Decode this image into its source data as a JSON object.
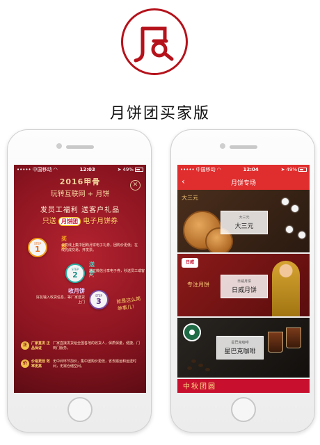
{
  "app": {
    "title": "月饼团买家版"
  },
  "status_bar": {
    "carrier": "中国移动",
    "time": "12:03",
    "battery": "49%"
  },
  "status_bar_right": {
    "carrier": "中国移动",
    "time": "12:04",
    "battery": "49%"
  },
  "left_screen": {
    "brand": "2016甲骨",
    "campaign": "玩转互联网 + 月饼",
    "close_icon": "close-icon",
    "banner_line1": "发员工福利  送客户礼品",
    "banner_prefix": "只送",
    "banner_badge": "月饼团",
    "banner_suffix": "电子月饼券",
    "steps": [
      {
        "word": "STEP",
        "num": "1",
        "label": "买券",
        "desc": "公司线上集中团购月饼电子礼券，团购价更低；在线完成交易，开发票。"
      },
      {
        "word": "STEP",
        "num": "2",
        "label": "送券",
        "desc": "通过微信分享电子券，秒送员工或客户。"
      },
      {
        "word": "STEP",
        "num": "3",
        "label": "收月饼",
        "desc": "好友输入收货信息，等厂家送货上门"
      }
    ],
    "slogan": "就是这么简单事儿！",
    "features": [
      {
        "icon": "正",
        "title": "厂家直发 正品保证",
        "desc": "厂家直接发货给全国各地的收货人，保质保量，便捷，门到门服务。"
      },
      {
        "icon": "价",
        "title": "价格更低 效率更高",
        "desc": "无中间环节加价，集中团购价更低，省去搬运和运送时间，无需仓储空间。"
      }
    ]
  },
  "right_screen": {
    "nav_title": "月饼专场",
    "back_icon": "back-arrow-icon",
    "cards": [
      {
        "brand_tag": "大三元",
        "overlay_small": "大三元",
        "overlay_big": "大三元"
      },
      {
        "logo": "日威",
        "side_text": "专注月饼",
        "overlay_small": "日威月饼",
        "overlay_big": "日威月饼"
      },
      {
        "overlay_small": "星巴克咖啡",
        "overlay_big": "星巴克咖啡"
      }
    ],
    "bottom_banner": "中秋团圆"
  },
  "colors": {
    "brand_red": "#b5121b",
    "nav_red": "#e02d2d",
    "left_bg": "#8a1420",
    "gold": "#ffd66b"
  }
}
